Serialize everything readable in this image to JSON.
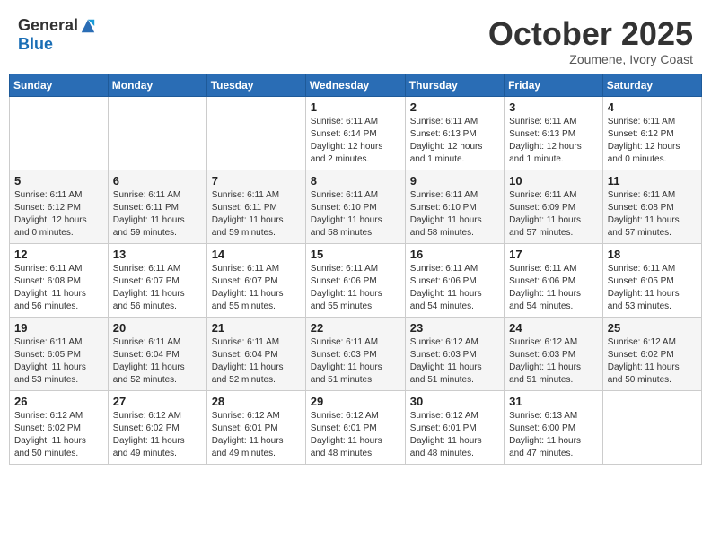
{
  "logo": {
    "general": "General",
    "blue": "Blue"
  },
  "header": {
    "month": "October 2025",
    "location": "Zoumene, Ivory Coast"
  },
  "weekdays": [
    "Sunday",
    "Monday",
    "Tuesday",
    "Wednesday",
    "Thursday",
    "Friday",
    "Saturday"
  ],
  "weeks": [
    [
      {
        "day": "",
        "info": ""
      },
      {
        "day": "",
        "info": ""
      },
      {
        "day": "",
        "info": ""
      },
      {
        "day": "1",
        "info": "Sunrise: 6:11 AM\nSunset: 6:14 PM\nDaylight: 12 hours\nand 2 minutes."
      },
      {
        "day": "2",
        "info": "Sunrise: 6:11 AM\nSunset: 6:13 PM\nDaylight: 12 hours\nand 1 minute."
      },
      {
        "day": "3",
        "info": "Sunrise: 6:11 AM\nSunset: 6:13 PM\nDaylight: 12 hours\nand 1 minute."
      },
      {
        "day": "4",
        "info": "Sunrise: 6:11 AM\nSunset: 6:12 PM\nDaylight: 12 hours\nand 0 minutes."
      }
    ],
    [
      {
        "day": "5",
        "info": "Sunrise: 6:11 AM\nSunset: 6:12 PM\nDaylight: 12 hours\nand 0 minutes."
      },
      {
        "day": "6",
        "info": "Sunrise: 6:11 AM\nSunset: 6:11 PM\nDaylight: 11 hours\nand 59 minutes."
      },
      {
        "day": "7",
        "info": "Sunrise: 6:11 AM\nSunset: 6:11 PM\nDaylight: 11 hours\nand 59 minutes."
      },
      {
        "day": "8",
        "info": "Sunrise: 6:11 AM\nSunset: 6:10 PM\nDaylight: 11 hours\nand 58 minutes."
      },
      {
        "day": "9",
        "info": "Sunrise: 6:11 AM\nSunset: 6:10 PM\nDaylight: 11 hours\nand 58 minutes."
      },
      {
        "day": "10",
        "info": "Sunrise: 6:11 AM\nSunset: 6:09 PM\nDaylight: 11 hours\nand 57 minutes."
      },
      {
        "day": "11",
        "info": "Sunrise: 6:11 AM\nSunset: 6:08 PM\nDaylight: 11 hours\nand 57 minutes."
      }
    ],
    [
      {
        "day": "12",
        "info": "Sunrise: 6:11 AM\nSunset: 6:08 PM\nDaylight: 11 hours\nand 56 minutes."
      },
      {
        "day": "13",
        "info": "Sunrise: 6:11 AM\nSunset: 6:07 PM\nDaylight: 11 hours\nand 56 minutes."
      },
      {
        "day": "14",
        "info": "Sunrise: 6:11 AM\nSunset: 6:07 PM\nDaylight: 11 hours\nand 55 minutes."
      },
      {
        "day": "15",
        "info": "Sunrise: 6:11 AM\nSunset: 6:06 PM\nDaylight: 11 hours\nand 55 minutes."
      },
      {
        "day": "16",
        "info": "Sunrise: 6:11 AM\nSunset: 6:06 PM\nDaylight: 11 hours\nand 54 minutes."
      },
      {
        "day": "17",
        "info": "Sunrise: 6:11 AM\nSunset: 6:06 PM\nDaylight: 11 hours\nand 54 minutes."
      },
      {
        "day": "18",
        "info": "Sunrise: 6:11 AM\nSunset: 6:05 PM\nDaylight: 11 hours\nand 53 minutes."
      }
    ],
    [
      {
        "day": "19",
        "info": "Sunrise: 6:11 AM\nSunset: 6:05 PM\nDaylight: 11 hours\nand 53 minutes."
      },
      {
        "day": "20",
        "info": "Sunrise: 6:11 AM\nSunset: 6:04 PM\nDaylight: 11 hours\nand 52 minutes."
      },
      {
        "day": "21",
        "info": "Sunrise: 6:11 AM\nSunset: 6:04 PM\nDaylight: 11 hours\nand 52 minutes."
      },
      {
        "day": "22",
        "info": "Sunrise: 6:11 AM\nSunset: 6:03 PM\nDaylight: 11 hours\nand 51 minutes."
      },
      {
        "day": "23",
        "info": "Sunrise: 6:12 AM\nSunset: 6:03 PM\nDaylight: 11 hours\nand 51 minutes."
      },
      {
        "day": "24",
        "info": "Sunrise: 6:12 AM\nSunset: 6:03 PM\nDaylight: 11 hours\nand 51 minutes."
      },
      {
        "day": "25",
        "info": "Sunrise: 6:12 AM\nSunset: 6:02 PM\nDaylight: 11 hours\nand 50 minutes."
      }
    ],
    [
      {
        "day": "26",
        "info": "Sunrise: 6:12 AM\nSunset: 6:02 PM\nDaylight: 11 hours\nand 50 minutes."
      },
      {
        "day": "27",
        "info": "Sunrise: 6:12 AM\nSunset: 6:02 PM\nDaylight: 11 hours\nand 49 minutes."
      },
      {
        "day": "28",
        "info": "Sunrise: 6:12 AM\nSunset: 6:01 PM\nDaylight: 11 hours\nand 49 minutes."
      },
      {
        "day": "29",
        "info": "Sunrise: 6:12 AM\nSunset: 6:01 PM\nDaylight: 11 hours\nand 48 minutes."
      },
      {
        "day": "30",
        "info": "Sunrise: 6:12 AM\nSunset: 6:01 PM\nDaylight: 11 hours\nand 48 minutes."
      },
      {
        "day": "31",
        "info": "Sunrise: 6:13 AM\nSunset: 6:00 PM\nDaylight: 11 hours\nand 47 minutes."
      },
      {
        "day": "",
        "info": ""
      }
    ]
  ]
}
